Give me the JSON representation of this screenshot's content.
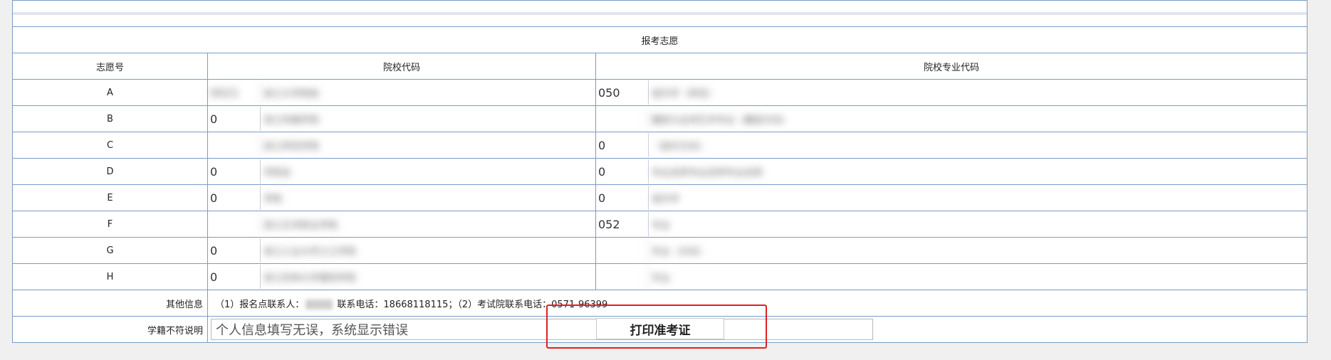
{
  "section_title": "报考志愿",
  "columns": {
    "choice_no": "志愿号",
    "school_code": "院校代码",
    "major_code": "院校专业代码"
  },
  "rows": [
    {
      "label": "A",
      "school_code": "0021",
      "school_name": "浙江大学院校",
      "major_code": "050",
      "major_name": "音乐学（师范）"
    },
    {
      "label": "B",
      "school_code": "0",
      "school_name": "浙江传媒学院",
      "major_code": "",
      "major_name": "播音与主持艺术专业（播音方向）"
    },
    {
      "label": "C",
      "school_code": "",
      "school_name": "浙江师范学院",
      "major_code": "0",
      "major_name": "（音乐方向）"
    },
    {
      "label": "D",
      "school_code": "0",
      "school_name": "学院名",
      "major_code": "0",
      "major_name": "专业名称专业名称专业名称"
    },
    {
      "label": "E",
      "school_code": "0",
      "school_name": "学院",
      "major_code": "0",
      "major_name": "音乐学"
    },
    {
      "label": "F",
      "school_code": "",
      "school_name": "浙江艺术职业学院",
      "major_code": "052",
      "major_name": "专业"
    },
    {
      "label": "G",
      "school_code": "0",
      "school_name": "浙江工业大学之江学院",
      "major_code": "",
      "major_name": "专业（方向）"
    },
    {
      "label": "H",
      "school_code": "0",
      "school_name": "浙江农林大学暨阳学院",
      "major_code": "",
      "major_name": "专业"
    }
  ],
  "other_info": {
    "label": "其他信息",
    "text_before": "（1）报名点联系人：",
    "text_after": " 联系电话：18668118115；（2）考试院联系电话：0571-96399"
  },
  "note": {
    "label": "学籍不符说明",
    "value": "个人信息填写无误，系统显示错误"
  },
  "print_button": "打印准考证",
  "colors": {
    "border": "#7a9cc4",
    "highlight": "#e02020"
  }
}
